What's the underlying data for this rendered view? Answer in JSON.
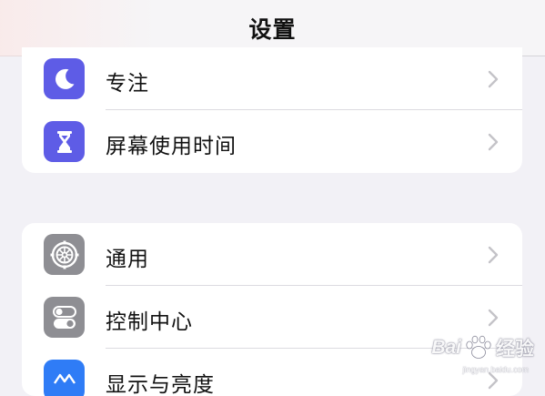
{
  "navbar": {
    "title": "设置"
  },
  "groups": [
    {
      "items": [
        {
          "label": "专注",
          "icon": "moon-icon",
          "icon_color": "#5e5ce6"
        },
        {
          "label": "屏幕使用时间",
          "icon": "hourglass-icon",
          "icon_color": "#5e5ce6"
        }
      ]
    },
    {
      "items": [
        {
          "label": "通用",
          "icon": "gear-icon",
          "icon_color": "#8e8e93"
        },
        {
          "label": "控制中心",
          "icon": "toggles-icon",
          "icon_color": "#8e8e93"
        },
        {
          "label": "显示与亮度",
          "icon": "brightness-icon",
          "icon_color": "#2f7cf6"
        }
      ]
    }
  ],
  "watermark": {
    "brand": "Bai",
    "brand_suffix": "经验",
    "url": "jingyan.baidu.com"
  },
  "colors": {
    "background": "#f2f1f6",
    "card": "#ffffff",
    "chevron": "#c4c3c8"
  }
}
